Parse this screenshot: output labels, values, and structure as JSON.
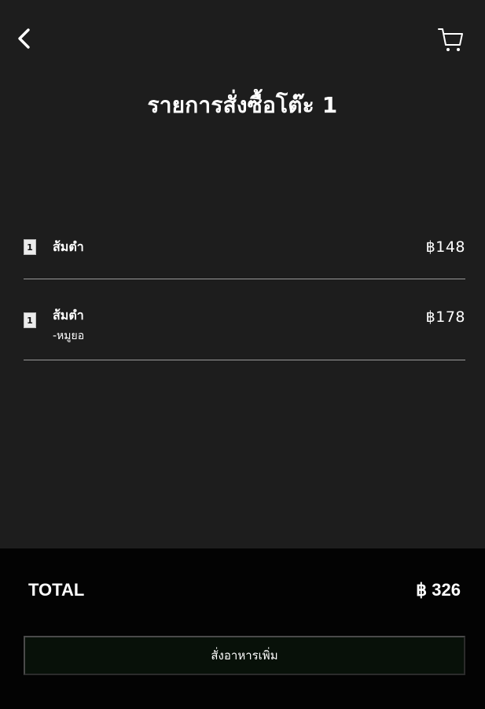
{
  "header": {
    "back_icon": "chevron-left-icon",
    "cart_icon": "shopping-cart-icon",
    "title": "รายการสั่งซื้อโต๊ะ 1"
  },
  "order_items": [
    {
      "quantity": "1",
      "name": "ส้มตำ",
      "option": "",
      "price": "฿148"
    },
    {
      "quantity": "1",
      "name": "ส้มตำ",
      "option": "-หมูยอ",
      "price": "฿178"
    }
  ],
  "summary": {
    "total_label": "TOTAL",
    "total_value": "฿ 326"
  },
  "actions": {
    "order_more_label": "สั่งอาหารเพิ่ม"
  },
  "colors": {
    "background": "#1d1d1d",
    "footer_background": "#030303",
    "button_background": "#081109",
    "divider": "#9a9a9a",
    "text": "#ffffff"
  }
}
